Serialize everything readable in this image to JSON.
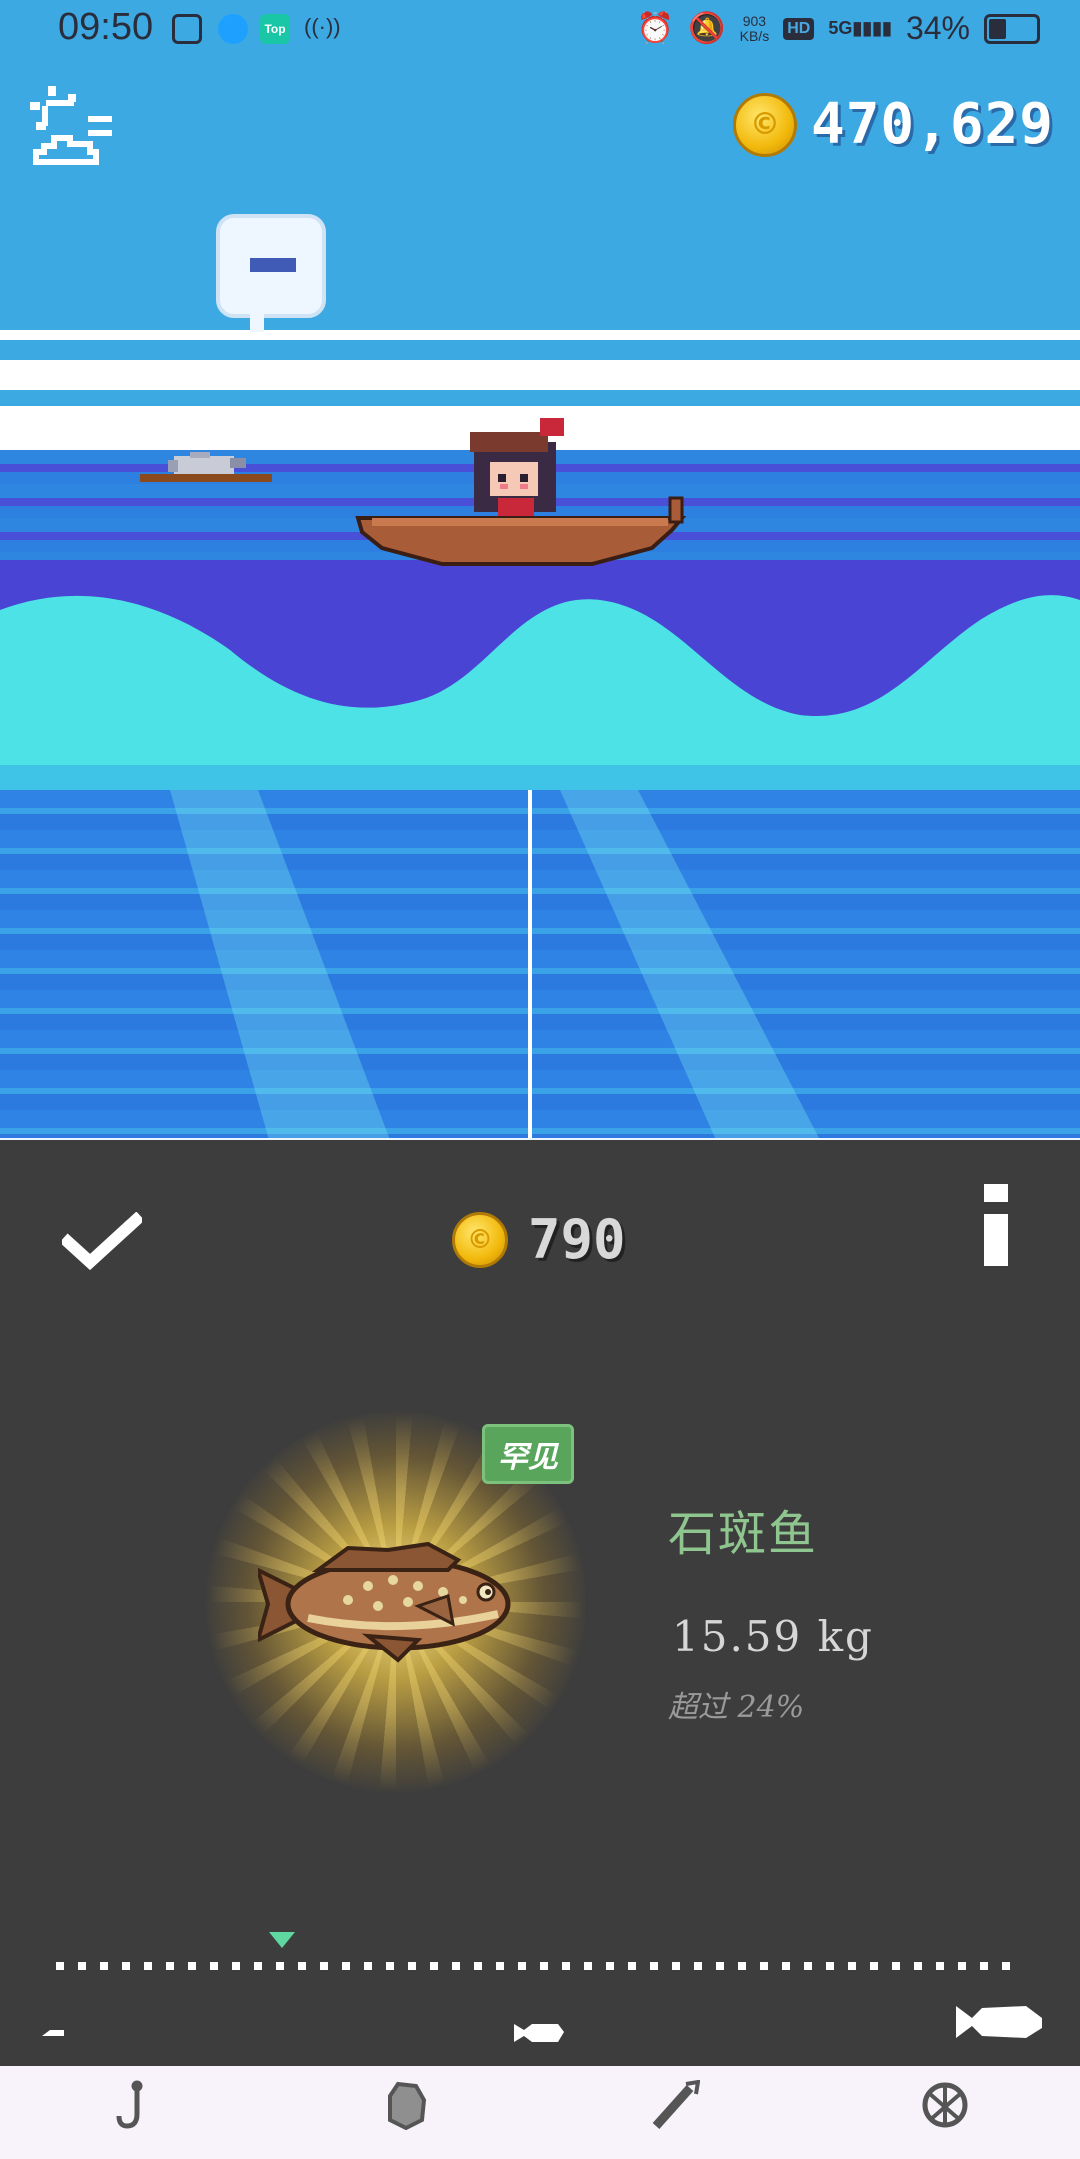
{
  "status_bar": {
    "time": "09:50",
    "network_speed_value": "903",
    "network_speed_unit": "KB/s",
    "hd_label": "HD",
    "signal_label": "5G",
    "battery_percent": "34%",
    "battery_level": 0.34,
    "app_icon_label": "Top"
  },
  "hud": {
    "coin_total": "470,629"
  },
  "result": {
    "reward_coins": "790",
    "rarity": "罕见",
    "fish_name": "石斑鱼",
    "weight": "15.59 kg",
    "percentile": "超过 24%"
  },
  "size_scale": {
    "marker_fraction": 0.235
  },
  "colors": {
    "sky": "#3da9e3",
    "panel": "#3d3d3d",
    "rarity_badge": "#5aa55c",
    "fish_name": "#8fc58e",
    "scale_marker": "#5ed7a0"
  },
  "icons": {
    "weather": "sun-cloud-icon",
    "confirm": "checkmark-icon",
    "info": "info-icon",
    "nav": [
      "hook-icon",
      "bait-icon",
      "rod-icon",
      "net-icon"
    ]
  }
}
